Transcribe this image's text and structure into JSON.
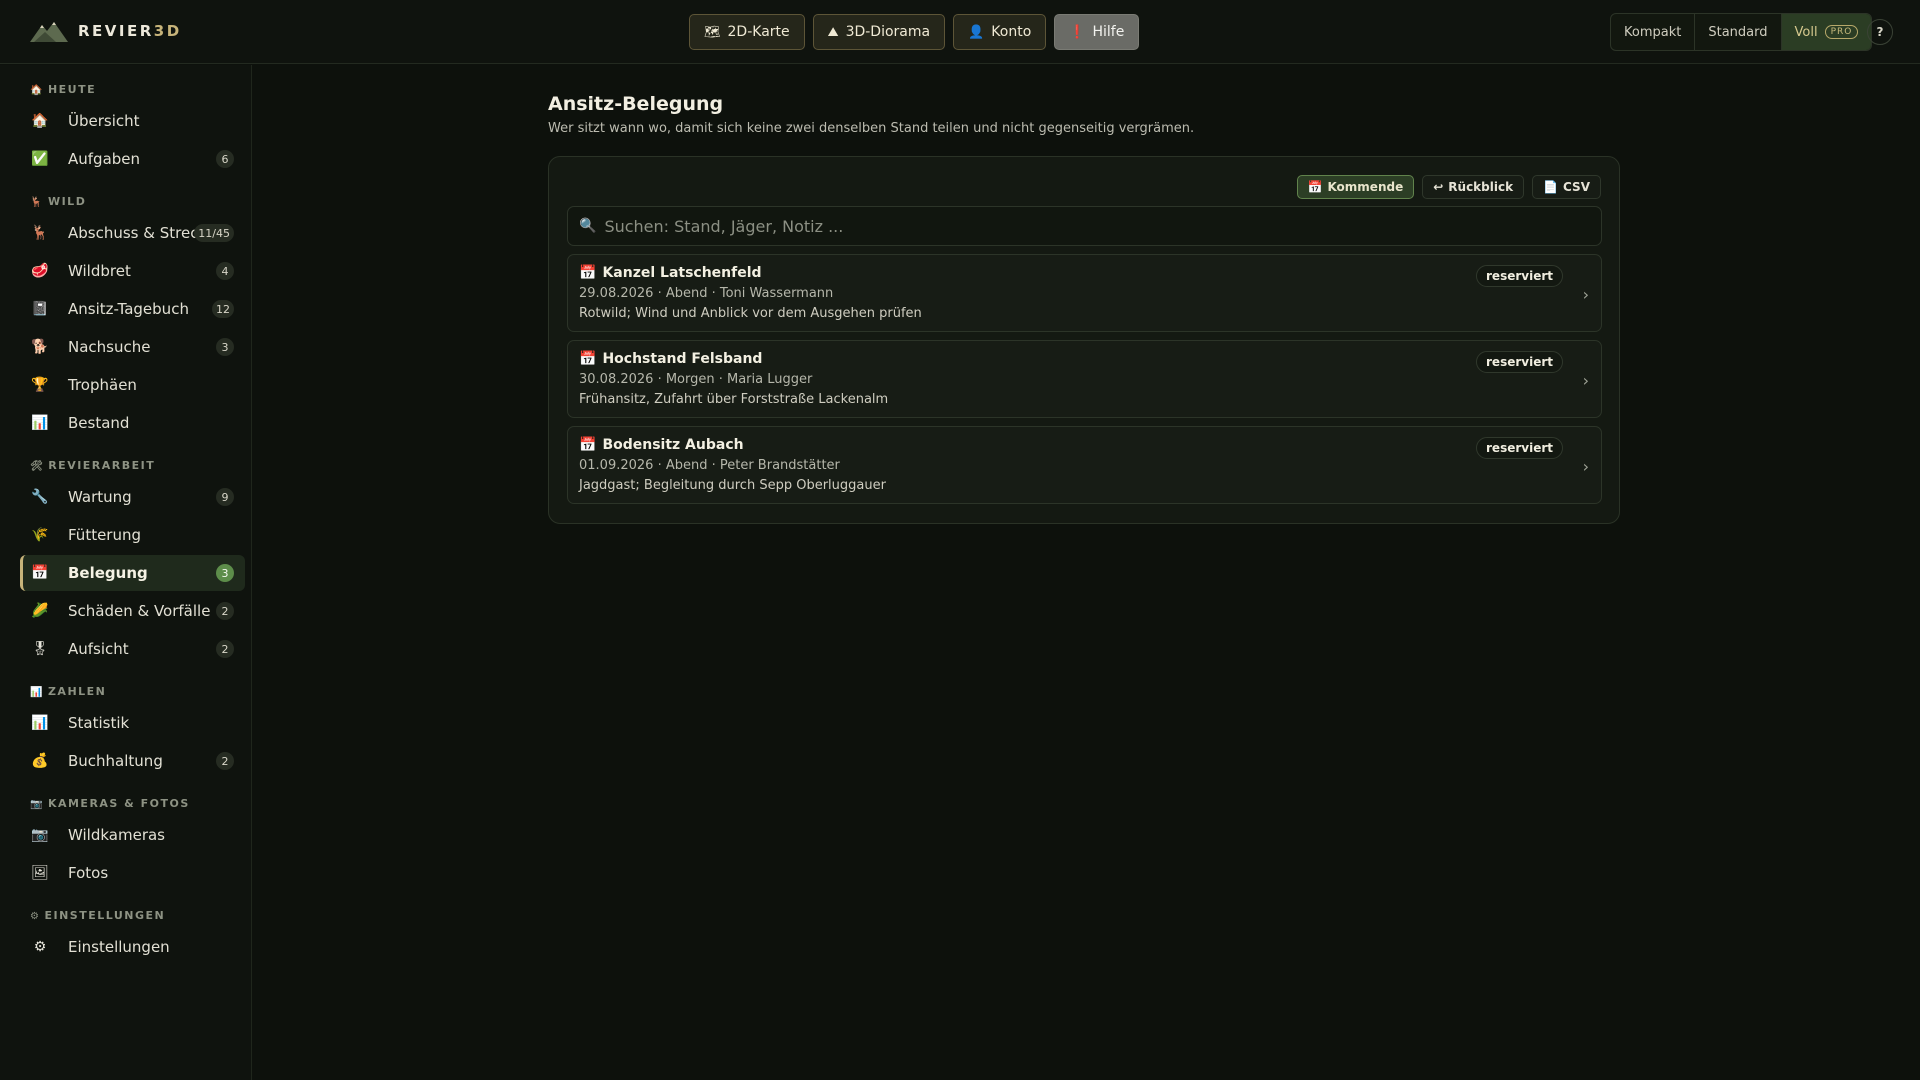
{
  "brand": {
    "name": "REVIER",
    "accent": "3D"
  },
  "nav": [
    {
      "label": "2D-Karte",
      "icon": "🗺"
    },
    {
      "label": "3D-Diorama",
      "icon": "⛰"
    },
    {
      "label": "Konto",
      "icon": "👤"
    },
    {
      "label": "Hilfe",
      "icon": "❗"
    }
  ],
  "view_modes": {
    "compact": "Kompakt",
    "standard": "Standard",
    "full": "Voll",
    "pro_badge": "PRO",
    "help": "?"
  },
  "sidebar": {
    "sections": [
      {
        "title": "HEUTE",
        "icon": "🏠"
      },
      {
        "title": "WILD",
        "icon": "🦌"
      },
      {
        "title": "REVIERARBEIT",
        "icon": "🛠"
      },
      {
        "title": "ZAHLEN",
        "icon": "📊"
      },
      {
        "title": "KAMERAS & FOTOS",
        "icon": "📷"
      },
      {
        "title": "EINSTELLUNGEN",
        "icon": "⚙"
      }
    ],
    "items": [
      {
        "label": "Übersicht",
        "icon": "🏠",
        "badge": ""
      },
      {
        "label": "Aufgaben",
        "icon": "✅",
        "badge": "6"
      },
      {
        "label": "Abschuss & Strec...",
        "icon": "🦌",
        "badge": "11/45"
      },
      {
        "label": "Wildbret",
        "icon": "🥩",
        "badge": "4"
      },
      {
        "label": "Ansitz-Tagebuch",
        "icon": "📓",
        "badge": "12"
      },
      {
        "label": "Nachsuche",
        "icon": "🐕",
        "badge": "3"
      },
      {
        "label": "Trophäen",
        "icon": "🏆",
        "badge": ""
      },
      {
        "label": "Bestand",
        "icon": "📊",
        "badge": ""
      },
      {
        "label": "Wartung",
        "icon": "🔧",
        "badge": "9"
      },
      {
        "label": "Fütterung",
        "icon": "🌾",
        "badge": ""
      },
      {
        "label": "Belegung",
        "icon": "📅",
        "badge": "3"
      },
      {
        "label": "Schäden & Vorfälle",
        "icon": "🌽",
        "badge": "2"
      },
      {
        "label": "Aufsicht",
        "icon": "🎖",
        "badge": "2"
      },
      {
        "label": "Statistik",
        "icon": "📊",
        "badge": ""
      },
      {
        "label": "Buchhaltung",
        "icon": "💰",
        "badge": "2"
      },
      {
        "label": "Wildkameras",
        "icon": "📷",
        "badge": ""
      },
      {
        "label": "Fotos",
        "icon": "🖼",
        "badge": ""
      },
      {
        "label": "Einstellungen",
        "icon": "⚙",
        "badge": ""
      }
    ]
  },
  "main": {
    "title": "Ansitz-Belegung",
    "subtitle": "Wer sitzt wann wo, damit sich keine zwei denselben Stand teilen und nicht gegenseitig vergrämen.",
    "filters": [
      {
        "label": "Kommende",
        "icon": "📅"
      },
      {
        "label": "Rückblick",
        "icon": "↩"
      },
      {
        "label": "CSV",
        "icon": "📄"
      }
    ],
    "search_placeholder": "Suchen: Stand, Jäger, Notiz ...",
    "entries": [
      {
        "title": "Kanzel Latschenfeld",
        "meta": "29.08.2026 · Abend · Toni Wassermann",
        "note": "Rotwild; Wind und Anblick vor dem Ausgehen prüfen",
        "status": "reserviert"
      },
      {
        "title": "Hochstand Felsband",
        "meta": "30.08.2026 · Morgen · Maria Lugger",
        "note": "Frühansitz, Zufahrt über Forststraße Lackenalm",
        "status": "reserviert"
      },
      {
        "title": "Bodensitz Aubach",
        "meta": "01.09.2026 · Abend · Peter Brandstätter",
        "note": "Jagdgast; Begleitung durch Sepp Oberluggauer",
        "status": "reserviert"
      }
    ]
  }
}
